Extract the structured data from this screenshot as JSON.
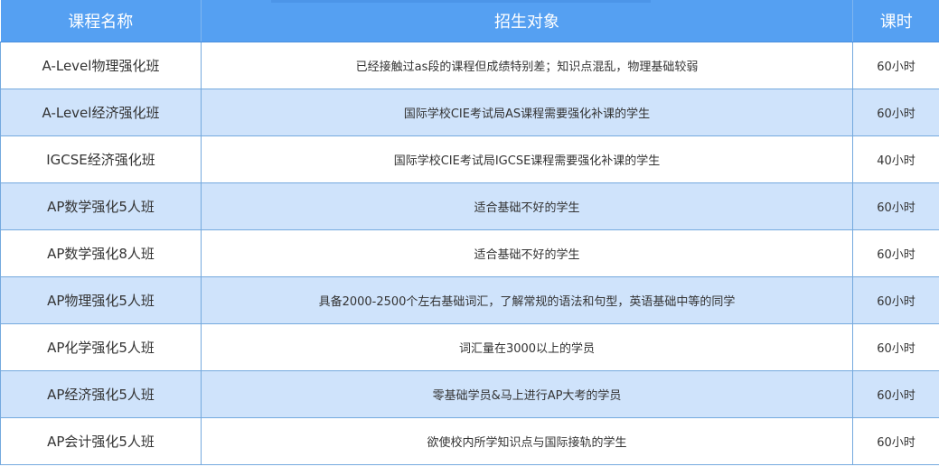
{
  "header": {
    "col_name": "课程名称",
    "col_target": "招生对象",
    "col_hours": "课时"
  },
  "rows": [
    {
      "name": "A-Level物理强化班",
      "target": "已经接触过as段的课程但成绩特别差；知识点混乱，物理基础较弱",
      "hours": "60小时"
    },
    {
      "name": "A-Level经济强化班",
      "target": "国际学校CIE考试局AS课程需要强化补课的学生",
      "hours": "60小时"
    },
    {
      "name": "IGCSE经济强化班",
      "target": "国际学校CIE考试局IGCSE课程需要强化补课的学生",
      "hours": "40小时"
    },
    {
      "name": "AP数学强化5人班",
      "target": "适合基础不好的学生",
      "hours": "60小时"
    },
    {
      "name": "AP数学强化8人班",
      "target": "适合基础不好的学生",
      "hours": "60小时"
    },
    {
      "name": "AP物理强化5人班",
      "target": "具备2000-2500个左右基础词汇，了解常规的语法和句型，英语基础中等的同学",
      "hours": "60小时"
    },
    {
      "name": "AP化学强化5人班",
      "target": "词汇量在3000以上的学员",
      "hours": "60小时"
    },
    {
      "name": "AP经济强化5人班",
      "target": "零基础学员&马上进行AP大考的学员",
      "hours": "60小时"
    },
    {
      "name": "AP会计强化5人班",
      "target": "欲使校内所学知识点与国际接轨的学生",
      "hours": "60小时"
    }
  ],
  "colors": {
    "header_bg": "#55a0f2",
    "alt_row_bg": "#cfe3fb",
    "border": "#74a9de"
  }
}
